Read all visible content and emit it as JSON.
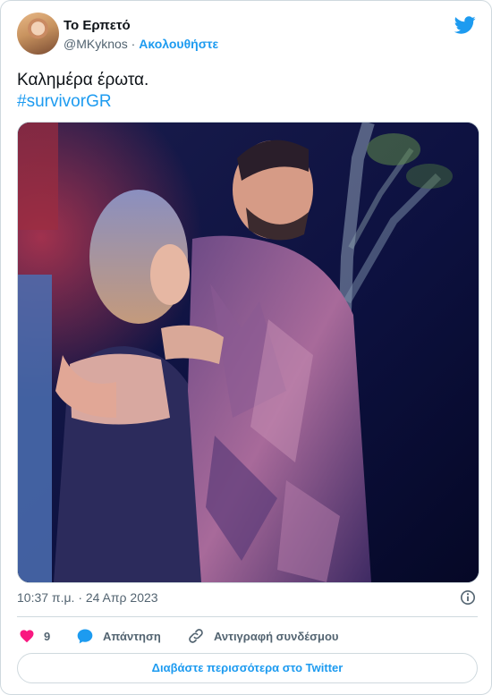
{
  "author": {
    "display_name": "Το Ερπετό",
    "handle": "@MKyknos",
    "separator": " · ",
    "follow_label": "Ακολουθήστε"
  },
  "tweet": {
    "text": "Καλημέρα έρωτα.",
    "hashtag": "#survivorGR"
  },
  "timestamp": "10:37 π.μ. · 24 Απρ 2023",
  "actions": {
    "like_count": "9",
    "reply_label": "Απάντηση",
    "copy_link_label": "Αντιγραφή συνδέσμου"
  },
  "read_more_label": "Διαβάστε περισσότερα στο Twitter",
  "icons": {
    "brand": "twitter-bird-icon",
    "info": "info-icon",
    "like": "heart-icon",
    "reply": "speech-bubble-icon",
    "copy_link": "link-icon"
  },
  "colors": {
    "accent": "#1d9bf0",
    "like": "#f91880",
    "text": "#0f1419",
    "muted": "#536471",
    "border": "#cfd9de"
  }
}
